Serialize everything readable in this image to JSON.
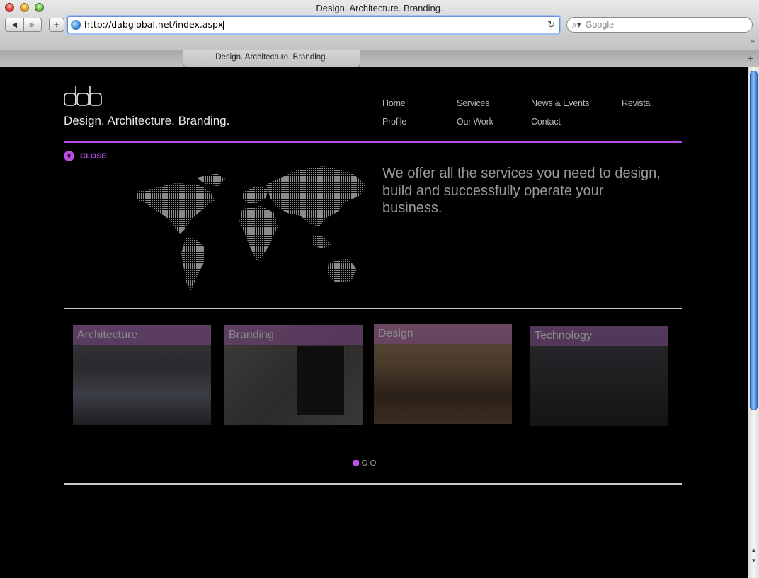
{
  "window": {
    "title": "Design. Architecture. Branding.",
    "back_glyph": "◀",
    "forward_glyph": "▶",
    "add_glyph": "+",
    "reload_glyph": "↻",
    "search_glyph": "⌕▾",
    "chevron_glyph": "»",
    "newtab_glyph": "+"
  },
  "toolbar": {
    "url": "http://dabglobal.net/index.aspx",
    "search_placeholder": "Google"
  },
  "tabs": [
    {
      "label": "Design. Architecture. Branding.",
      "active": true
    }
  ],
  "site": {
    "tagline": "Design. Architecture. Branding.",
    "nav": [
      {
        "label": "Home"
      },
      {
        "label": "Services"
      },
      {
        "label": "News & Events"
      },
      {
        "label": "Revista"
      },
      {
        "label": "Profile"
      },
      {
        "label": "Our Work"
      },
      {
        "label": "Contact"
      }
    ],
    "close_label": "CLOSE",
    "headline": "We offer all the services you need to design, build and successfully operate your business.",
    "cards": [
      {
        "label": "Architecture"
      },
      {
        "label": "Branding"
      },
      {
        "label": "Design"
      },
      {
        "label": "Technology"
      }
    ],
    "carousel": {
      "pages": 3,
      "active_index": 0
    },
    "colors": {
      "accent": "#b94ee6",
      "background": "#000000",
      "text_muted": "#9a9a9a"
    }
  }
}
